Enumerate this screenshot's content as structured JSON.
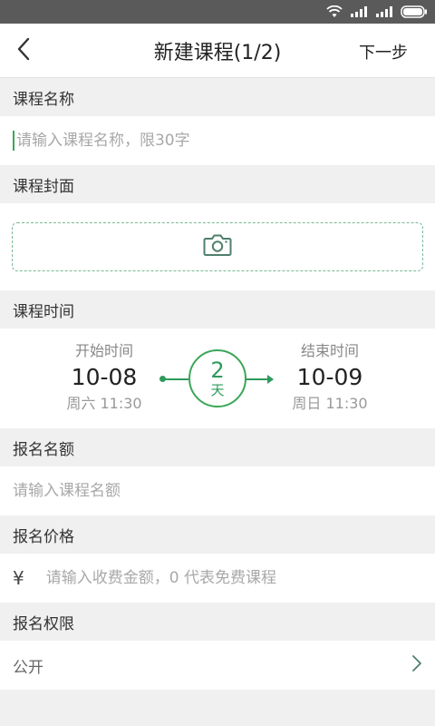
{
  "nav": {
    "title": "新建课程(1/2)",
    "next_label": "下一步",
    "back_icon": "chevron-left-icon"
  },
  "course_name": {
    "label": "课程名称",
    "placeholder": "请输入课程名称，限30字"
  },
  "course_cover": {
    "label": "课程封面",
    "icon": "camera-icon"
  },
  "course_time": {
    "label": "课程时间",
    "start": {
      "label": "开始时间",
      "date": "10-08",
      "weekday_time": "周六 11:30"
    },
    "end": {
      "label": "结束时间",
      "date": "10-09",
      "weekday_time": "周日 11:30"
    },
    "duration": {
      "value": "2",
      "unit": "天"
    }
  },
  "quota": {
    "label": "报名名额",
    "placeholder": "请输入课程名额"
  },
  "price": {
    "label": "报名价格",
    "currency": "¥",
    "placeholder": "请输入收费金额，0 代表免费课程"
  },
  "permission": {
    "label": "报名权限",
    "value": "公开"
  },
  "colors": {
    "accent": "#2e9a5c",
    "status_bar": "#5a5a5a"
  }
}
